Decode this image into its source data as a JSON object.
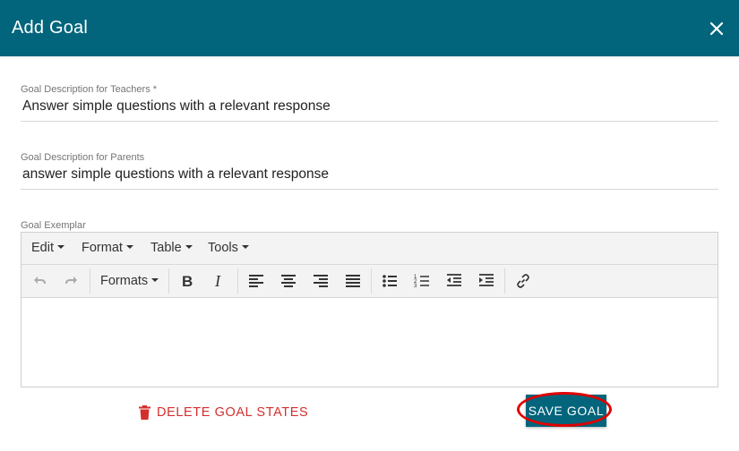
{
  "dialog": {
    "title": "Add Goal",
    "close_icon": "close-icon"
  },
  "fields": {
    "teachers": {
      "label": "Goal Description for Teachers *",
      "value": "Answer simple questions with a relevant response"
    },
    "parents": {
      "label": "Goal Description for Parents",
      "value": "answer simple questions with a relevant response"
    },
    "exemplar": {
      "label": "Goal Exemplar"
    }
  },
  "editor": {
    "menu": [
      "Edit",
      "Format",
      "Table",
      "Tools"
    ],
    "formats_label": "Formats",
    "icons": [
      "undo-icon",
      "redo-icon",
      "bold-icon",
      "italic-icon",
      "align-left-icon",
      "align-center-icon",
      "align-right-icon",
      "align-justify-icon",
      "bullet-list-icon",
      "numbered-list-icon",
      "outdent-icon",
      "indent-icon",
      "link-icon"
    ]
  },
  "actions": {
    "delete_label": "DELETE GOAL STATES",
    "save_label": "SAVE GOAL"
  },
  "colors": {
    "header": "#02657c",
    "delete": "#d32f2f",
    "highlight": "#e00000"
  }
}
